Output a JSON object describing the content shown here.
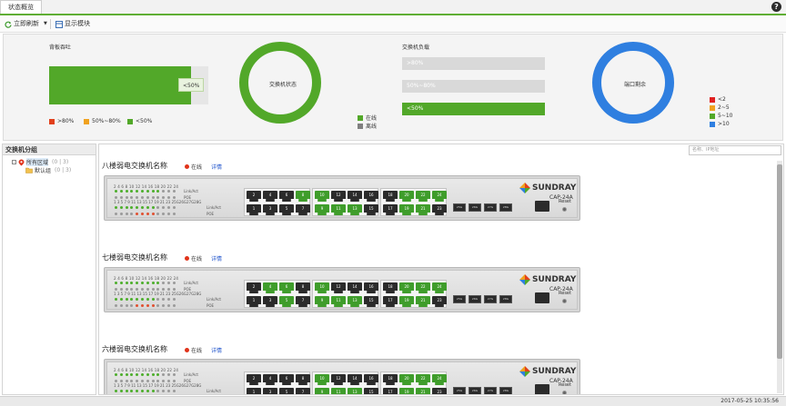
{
  "tab": {
    "title": "状态概览"
  },
  "toolbar": {
    "refresh": "立即刷新",
    "modules": "显示模块"
  },
  "backplane": {
    "title": "背板吞吐",
    "bar_label": "<50%",
    "bar_fraction": 0.89,
    "legend": [
      {
        "label": ">80%",
        "color": "#e2401c"
      },
      {
        "label": "50%~80%",
        "color": "#f0a21f"
      },
      {
        "label": "<50%",
        "color": "#52a829"
      }
    ]
  },
  "switch_status": {
    "title": "交换机状态",
    "legend": [
      {
        "label": "在线",
        "color": "#52a829"
      },
      {
        "label": "离线",
        "color": "#808080"
      }
    ]
  },
  "switch_load": {
    "title": "交换机负载",
    "bars": [
      {
        "label": ">80%",
        "fraction": 0,
        "color": "#e2401c"
      },
      {
        "label": "50%~80%",
        "fraction": 0,
        "color": "#f0a21f"
      },
      {
        "label": "<50%",
        "fraction": 1,
        "color": "#52a829"
      }
    ]
  },
  "port_remaining": {
    "title": "端口剩余",
    "legend": [
      {
        "label": "<2",
        "color": "#e02020"
      },
      {
        "label": "2~5",
        "color": "#f0a21f"
      },
      {
        "label": "5~10",
        "color": "#52a829"
      },
      {
        "label": ">10",
        "color": "#2f7fe0"
      }
    ]
  },
  "left_panel": {
    "title": "交换机分组",
    "root": "所有区域",
    "root_count": "(0 | 3)",
    "child": "默认组",
    "child_count": "(0 | 3)"
  },
  "search": {
    "placeholder": "名称、IP地址"
  },
  "switches": [
    {
      "name": "八楼弱电交换机名称",
      "status": "在线",
      "detail": "详情",
      "top_ports": [
        "2",
        "4",
        "6",
        "8",
        "10",
        "12",
        "14",
        "16",
        "18",
        "20",
        "22",
        "24"
      ],
      "bottom_ports": [
        "1",
        "3",
        "5",
        "7",
        "9",
        "11",
        "13",
        "15",
        "17",
        "19",
        "21",
        "23"
      ],
      "top_active": [
        3,
        4,
        9,
        10,
        11
      ],
      "bottom_active": [
        4,
        5,
        6,
        9,
        10
      ]
    },
    {
      "name": "七楼弱电交换机名称",
      "status": "在线",
      "detail": "详情",
      "top_ports": [
        "2",
        "4",
        "6",
        "8",
        "10",
        "12",
        "14",
        "16",
        "18",
        "20",
        "22",
        "24"
      ],
      "bottom_ports": [
        "1",
        "3",
        "5",
        "7",
        "9",
        "11",
        "13",
        "15",
        "17",
        "19",
        "21",
        "23"
      ],
      "top_active": [
        1,
        2,
        4,
        9,
        10,
        11
      ],
      "bottom_active": [
        2,
        4,
        5,
        6,
        9,
        10
      ]
    },
    {
      "name": "六楼弱电交换机名称",
      "status": "在线",
      "detail": "详情",
      "top_ports": [
        "2",
        "4",
        "6",
        "8",
        "10",
        "12",
        "14",
        "16",
        "18",
        "20",
        "22",
        "24"
      ],
      "bottom_ports": [
        "1",
        "3",
        "5",
        "7",
        "9",
        "11",
        "13",
        "15",
        "17",
        "19",
        "21",
        "23"
      ],
      "top_active": [
        4,
        9,
        10,
        11
      ],
      "bottom_active": [
        4,
        5,
        6,
        9,
        10
      ]
    }
  ],
  "device": {
    "brand": "SUNDRAY",
    "model": "CAP-24A",
    "reset": "Reset",
    "led_top": "2 4 6 8 10 12 14 16 18 20 22 24",
    "led_bottom": "1 3 5 7 9 11 13 15 17 19 21 23 25G26G27G28G",
    "link_act": "Link/Act",
    "poe": "POE",
    "sfp": [
      "25G",
      "26G",
      "27G",
      "28G"
    ]
  },
  "footer": {
    "timestamp": "2017-05-25 10:35:56"
  }
}
